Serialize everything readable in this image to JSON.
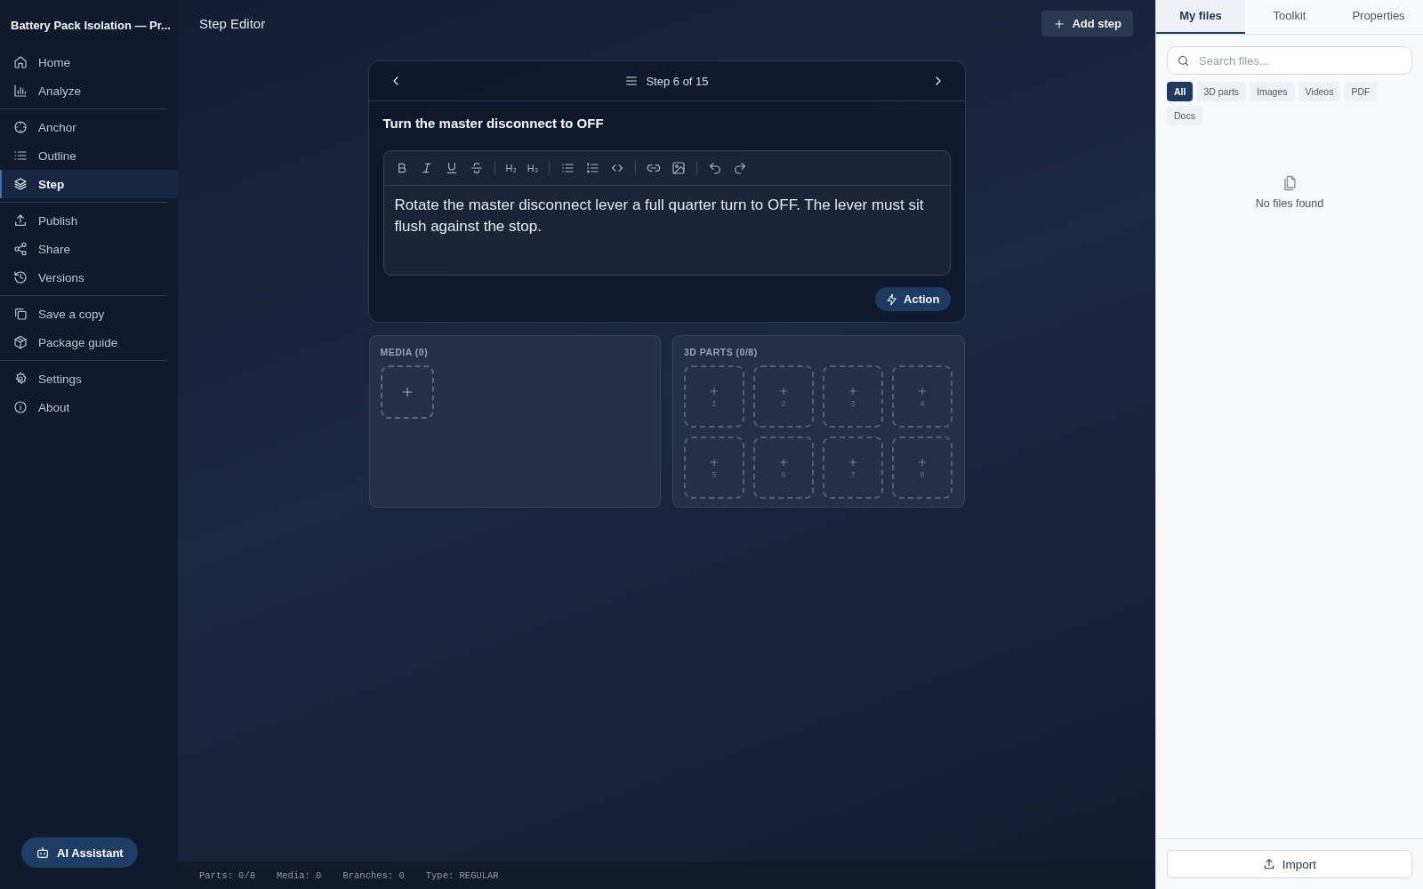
{
  "sidebar": {
    "title": "Battery Pack Isolation — Pr...",
    "groups": [
      [
        {
          "label": "Home",
          "selected": false
        },
        {
          "label": "Analyze",
          "selected": false
        }
      ],
      [
        {
          "label": "Anchor",
          "selected": false
        },
        {
          "label": "Outline",
          "selected": false
        },
        {
          "label": "Step",
          "selected": true
        }
      ],
      [
        {
          "label": "Publish",
          "selected": false
        },
        {
          "label": "Share",
          "selected": false
        },
        {
          "label": "Versions",
          "selected": false
        }
      ],
      [
        {
          "label": "Save a copy",
          "selected": false
        },
        {
          "label": "Package guide",
          "selected": false
        }
      ],
      [
        {
          "label": "Settings",
          "selected": false
        },
        {
          "label": "About",
          "selected": false
        }
      ]
    ],
    "assistant_button": "AI Assistant"
  },
  "header": {
    "title": "Step Editor",
    "add_button": "Add step"
  },
  "step": {
    "counter": "Step 6 of 15",
    "title": "Turn the master disconnect to OFF",
    "heading_buttons": [
      "H₂",
      "H₃"
    ],
    "body": "Rotate the master disconnect lever a full quarter turn to OFF. The lever must sit flush against the stop.",
    "action_button": "Action"
  },
  "media": {
    "heading": "MEDIA (0)"
  },
  "parts": {
    "heading": "3D PARTS (0/8)",
    "slots": [
      "1",
      "2",
      "3",
      "4",
      "5",
      "6",
      "7",
      "8"
    ]
  },
  "status_bar": [
    "Parts: 0/8",
    "Media: 0",
    "Branches: 0",
    "Type: REGULAR"
  ],
  "files_panel": {
    "tabs": [
      {
        "label": "My files",
        "selected": true
      },
      {
        "label": "Toolkit",
        "selected": false
      },
      {
        "label": "Properties",
        "selected": false
      }
    ],
    "search": {
      "placeholder": "Search files..."
    },
    "filters": [
      {
        "label": "All",
        "selected": true
      },
      {
        "label": "3D parts",
        "selected": false
      },
      {
        "label": "Images",
        "selected": false
      },
      {
        "label": "Videos",
        "selected": false
      },
      {
        "label": "PDF",
        "selected": false
      },
      {
        "label": "Docs",
        "selected": false
      }
    ],
    "empty_text": "No files found",
    "import_button": "Import"
  }
}
